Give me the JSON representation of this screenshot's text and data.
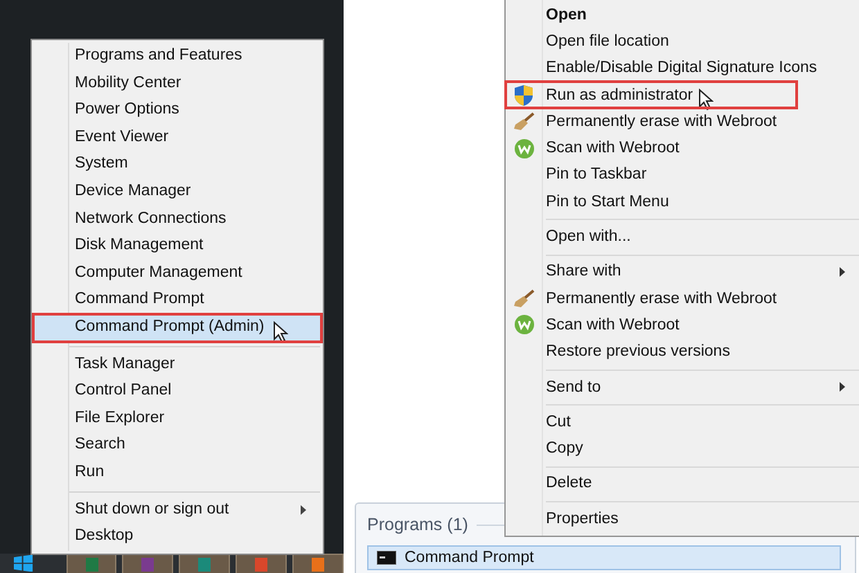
{
  "power_menu": {
    "groups": [
      [
        {
          "label": "Programs and Features",
          "selected": false,
          "submenu": false
        },
        {
          "label": "Mobility Center",
          "selected": false,
          "submenu": false
        },
        {
          "label": "Power Options",
          "selected": false,
          "submenu": false
        },
        {
          "label": "Event Viewer",
          "selected": false,
          "submenu": false
        },
        {
          "label": "System",
          "selected": false,
          "submenu": false
        },
        {
          "label": "Device Manager",
          "selected": false,
          "submenu": false
        },
        {
          "label": "Network Connections",
          "selected": false,
          "submenu": false
        },
        {
          "label": "Disk Management",
          "selected": false,
          "submenu": false
        },
        {
          "label": "Computer Management",
          "selected": false,
          "submenu": false
        },
        {
          "label": "Command Prompt",
          "selected": false,
          "submenu": false
        },
        {
          "label": "Command Prompt (Admin)",
          "selected": true,
          "submenu": false
        }
      ],
      [
        {
          "label": "Task Manager",
          "selected": false,
          "submenu": false
        },
        {
          "label": "Control Panel",
          "selected": false,
          "submenu": false
        },
        {
          "label": "File Explorer",
          "selected": false,
          "submenu": false
        },
        {
          "label": "Search",
          "selected": false,
          "submenu": false
        },
        {
          "label": "Run",
          "selected": false,
          "submenu": false
        }
      ],
      [
        {
          "label": "Shut down or sign out",
          "selected": false,
          "submenu": true
        },
        {
          "label": "Desktop",
          "selected": false,
          "submenu": false
        }
      ]
    ]
  },
  "taskbar": {
    "apps": [
      {
        "color": "#1f7a45"
      },
      {
        "color": "#7a3b8f"
      },
      {
        "color": "#1b8a7a"
      },
      {
        "color": "#d9472b"
      },
      {
        "color": "#e8701a"
      }
    ]
  },
  "search_results": {
    "section_title": "Programs (1)",
    "results": [
      {
        "label": "Command Prompt",
        "selected": true
      }
    ]
  },
  "context_menu": {
    "groups": [
      [
        {
          "label": "Open",
          "default": true,
          "selected": false,
          "submenu": false
        },
        {
          "label": "Open file location",
          "default": false,
          "selected": false,
          "submenu": false
        },
        {
          "label": "Enable/Disable Digital Signature Icons",
          "default": false,
          "selected": false,
          "submenu": false
        },
        {
          "label": "Run as administrator",
          "kind": "shield",
          "default": false,
          "selected": true,
          "submenu": false
        },
        {
          "label": "Permanently erase with Webroot",
          "kind": "broom",
          "default": false,
          "selected": false,
          "submenu": false
        },
        {
          "label": "Scan with Webroot",
          "kind": "webroot",
          "default": false,
          "selected": false,
          "submenu": false
        },
        {
          "label": "Pin to Taskbar",
          "default": false,
          "selected": false,
          "submenu": false
        },
        {
          "label": "Pin to Start Menu",
          "default": false,
          "selected": false,
          "submenu": false
        }
      ],
      [
        {
          "label": "Open with...",
          "default": false,
          "selected": false,
          "submenu": false
        }
      ],
      [
        {
          "label": "Share with",
          "default": false,
          "selected": false,
          "submenu": true
        },
        {
          "label": "Permanently erase with Webroot",
          "kind": "broom",
          "default": false,
          "selected": false,
          "submenu": false
        },
        {
          "label": "Scan with Webroot",
          "kind": "webroot",
          "default": false,
          "selected": false,
          "submenu": false
        },
        {
          "label": "Restore previous versions",
          "default": false,
          "selected": false,
          "submenu": false
        }
      ],
      [
        {
          "label": "Send to",
          "default": false,
          "selected": false,
          "submenu": true
        }
      ],
      [
        {
          "label": "Cut",
          "default": false,
          "selected": false,
          "submenu": false
        },
        {
          "label": "Copy",
          "default": false,
          "selected": false,
          "submenu": false
        }
      ],
      [
        {
          "label": "Delete",
          "default": false,
          "selected": false,
          "submenu": false
        }
      ],
      [
        {
          "label": "Properties",
          "default": false,
          "selected": false,
          "submenu": false
        }
      ]
    ]
  }
}
